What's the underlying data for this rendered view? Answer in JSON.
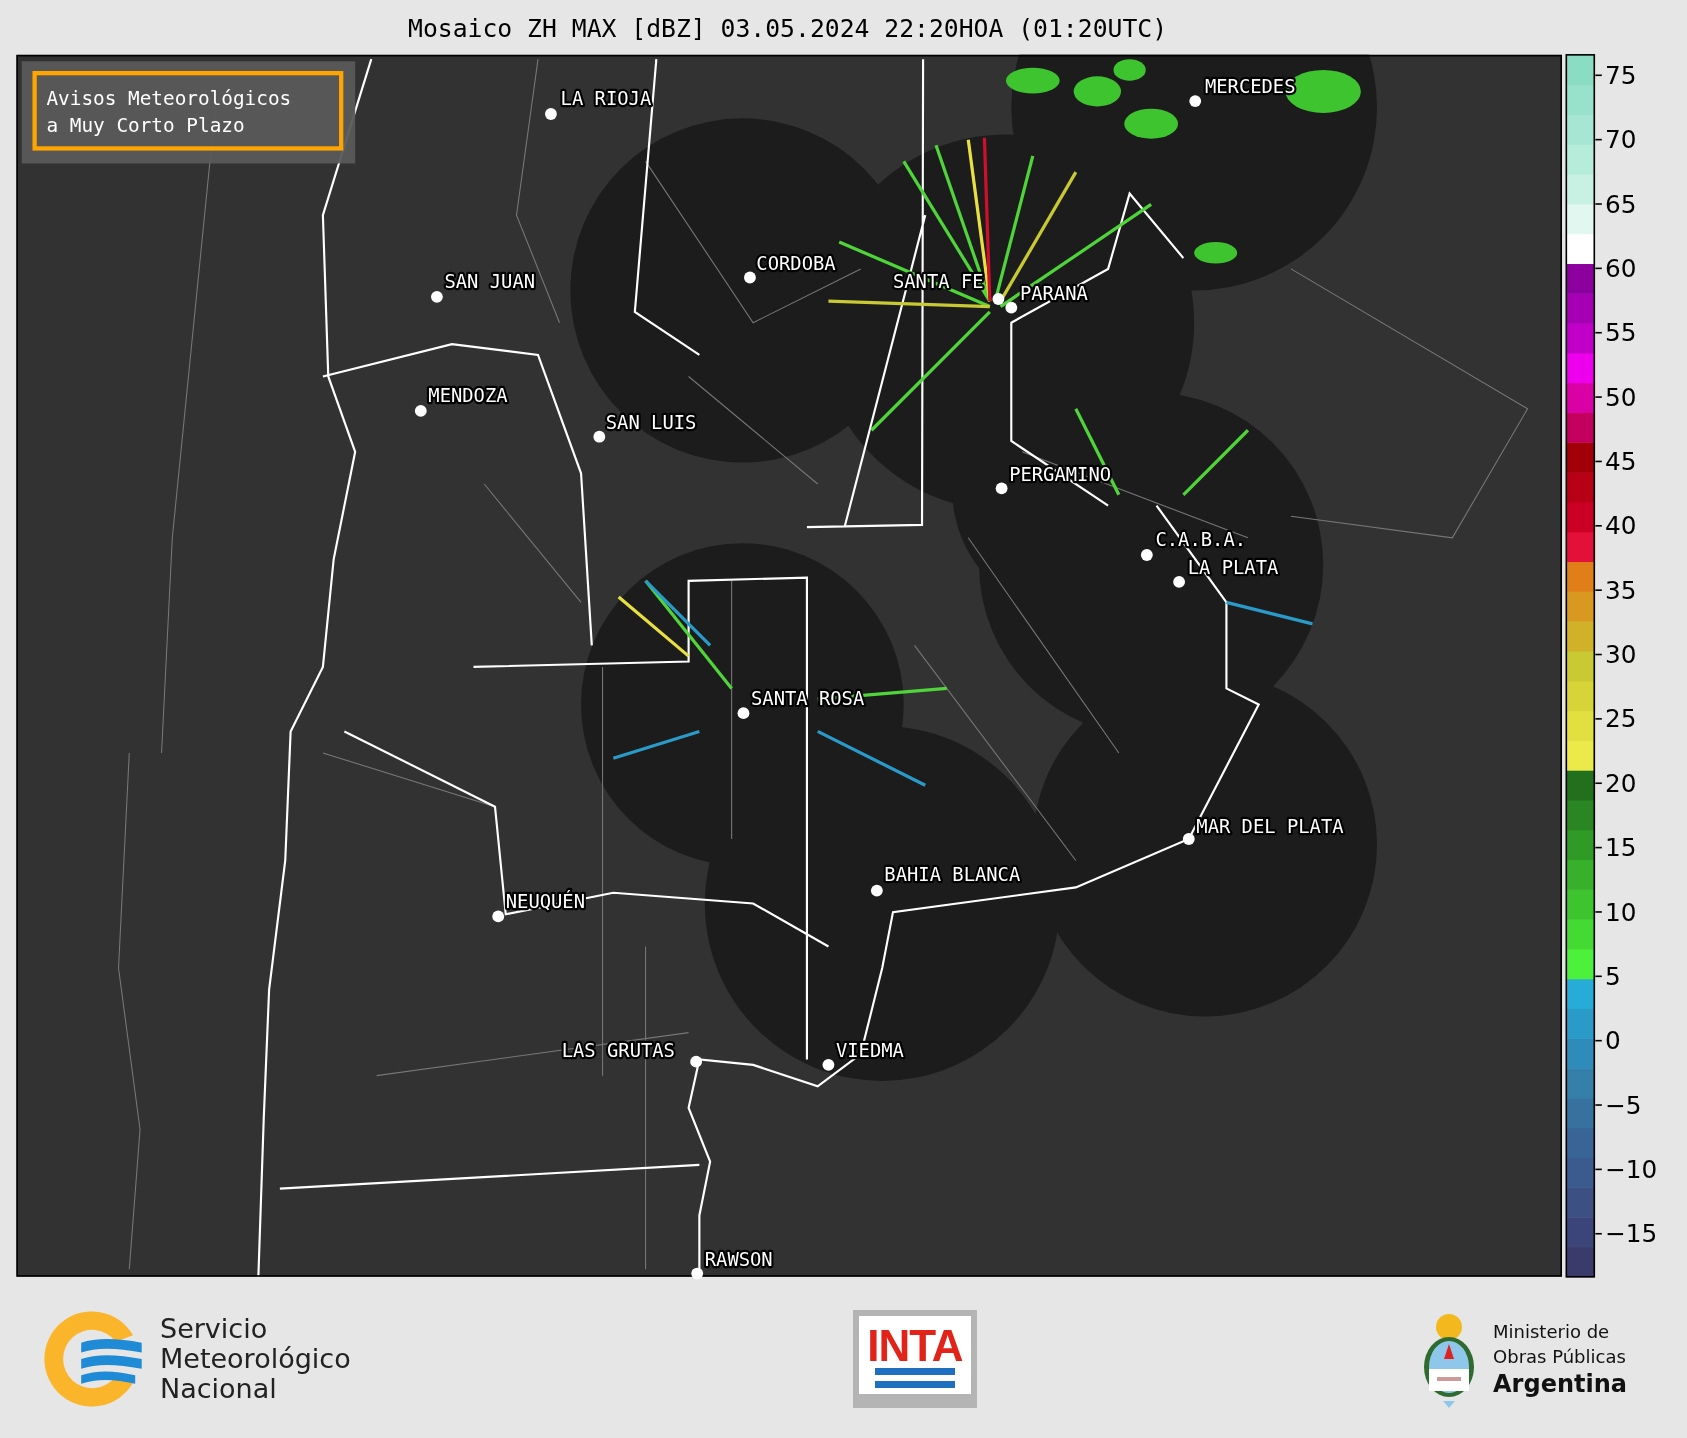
{
  "title": "Mosaico ZH MAX [dBZ] 03.05.2024 22:20HOA (01:20UTC)",
  "notice": {
    "lines": [
      "Avisos Meteorológicos",
      "a Muy Corto Plazo"
    ]
  },
  "map": {
    "cities": [
      {
        "name": "LA RIOJA"
      },
      {
        "name": "CORDOBA"
      },
      {
        "name": "SAN JUAN"
      },
      {
        "name": "SANTA FE"
      },
      {
        "name": "PARANA"
      },
      {
        "name": "MERCEDES"
      },
      {
        "name": "MENDOZA"
      },
      {
        "name": "SAN LUIS"
      },
      {
        "name": "PERGAMINO"
      },
      {
        "name": "C.A.B.A."
      },
      {
        "name": "LA PLATA"
      },
      {
        "name": "SANTA ROSA"
      },
      {
        "name": "MAR DEL PLATA"
      },
      {
        "name": "BAHIA BLANCA"
      },
      {
        "name": "NEUQUÉN"
      },
      {
        "name": "LAS GRUTAS"
      },
      {
        "name": "VIEDMA"
      },
      {
        "name": "RAWSON"
      }
    ]
  },
  "colorbar": {
    "ticks": [
      "75",
      "70",
      "65",
      "60",
      "55",
      "50",
      "45",
      "40",
      "35",
      "30",
      "25",
      "20",
      "15",
      "10",
      "5",
      "0",
      "−5",
      "−10",
      "−15"
    ]
  },
  "footer": {
    "smn": {
      "lines": [
        "Servicio",
        "Meteorológico",
        "Nacional"
      ]
    },
    "inta": {
      "text": "INTA"
    },
    "ministry": {
      "lines": [
        "Ministerio de",
        "Obras Públicas",
        "Argentina"
      ]
    }
  }
}
